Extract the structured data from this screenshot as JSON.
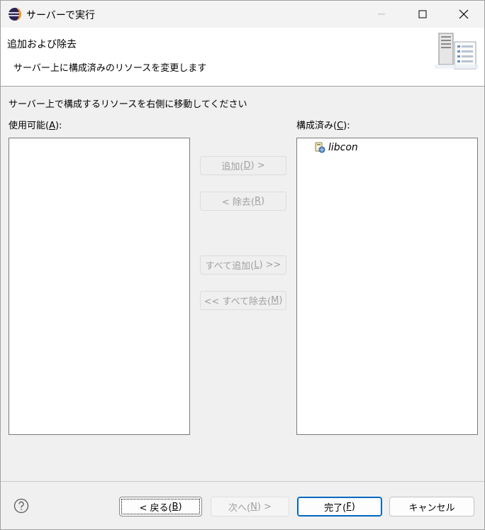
{
  "window": {
    "title": "サーバーで実行"
  },
  "banner": {
    "title": "追加および除去",
    "message": "サーバー上に構成済みのリソースを変更します",
    "graphic_icon": "server-list-graphic-icon"
  },
  "instruction": "サーバー上で構成するリソースを右側に移動してください",
  "available": {
    "label_text": "使用可能(",
    "label_mnemonic": "A",
    "label_suffix": "):",
    "items": []
  },
  "configured": {
    "label_text": "構成済み(",
    "label_mnemonic": "C",
    "label_suffix": "):",
    "items": [
      {
        "name": "libcon",
        "icon": "web-module-icon"
      }
    ]
  },
  "middle_buttons": {
    "add": {
      "pre": "追加(",
      "mnemonic": "D",
      "post": ") >",
      "enabled": false
    },
    "remove": {
      "pre": "< 除去(",
      "mnemonic": "R",
      "post": ")",
      "enabled": false
    },
    "add_all": {
      "pre": "すべて追加(",
      "mnemonic": "L",
      "post": ") >>",
      "enabled": false
    },
    "remove_all": {
      "pre": "<< すべて除去(",
      "mnemonic": "M",
      "post": ")",
      "enabled": false
    }
  },
  "footer": {
    "back": {
      "pre": "< 戻る(",
      "mnemonic": "B",
      "post": ")"
    },
    "next": {
      "pre": "次へ(",
      "mnemonic": "N",
      "post": ") >",
      "enabled": false
    },
    "finish": {
      "pre": "完了(",
      "mnemonic": "F",
      "post": ")"
    },
    "cancel": "キャンセル"
  }
}
